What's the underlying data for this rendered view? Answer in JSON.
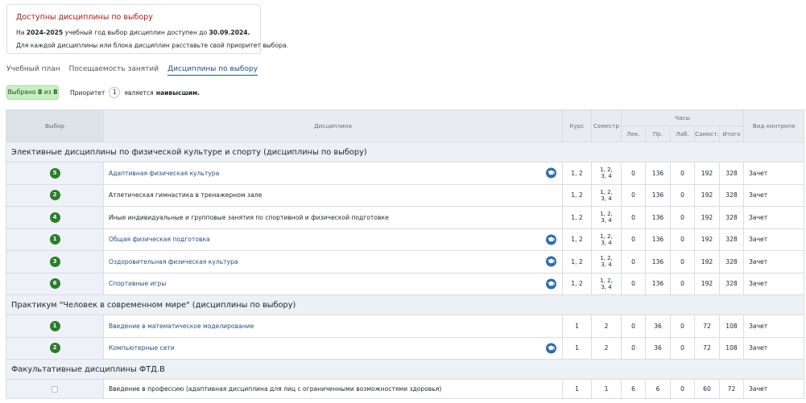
{
  "notice": {
    "title": "Доступны дисциплины по выбору",
    "line1_pre": "На ",
    "line1_year": "2024-2025",
    "line1_mid": " учебный год выбор дисциплин доступен до ",
    "line1_date": "30.09.2024.",
    "line2": "Для каждой дисциплины или блока дисциплин расставьте свой приоритет выбора."
  },
  "tabs": [
    {
      "label": "Учебный план",
      "active": false
    },
    {
      "label": "Посещаемость занятий",
      "active": false
    },
    {
      "label": "Дисциплины по выбору",
      "active": true
    }
  ],
  "selection": {
    "pre": "Выбрано ",
    "selected": "8",
    "mid": " из ",
    "total": "8"
  },
  "priority_note": {
    "pre": "Приоритет",
    "value": "1",
    "mid": "является",
    "bold": "наивысшим."
  },
  "table": {
    "headers": {
      "select": "Выбор",
      "discipline": "Дисциплина",
      "course": "Курс",
      "semester": "Семестр",
      "hours": "Часы",
      "lec": "Лек.",
      "pr": "Пр.",
      "lab": "Лаб.",
      "self": "Самост.",
      "total": "Итого",
      "control": "Вид контроля"
    },
    "sections": [
      {
        "title": "Элективные дисциплины по физической культуре и спорту (дисциплины по выбору)",
        "rows": [
          {
            "priority": "5",
            "name": "Адаптивная физическая культура",
            "link": true,
            "cap_icon": true,
            "course": "1, 2",
            "sem1": "1, 2,",
            "sem2": "3, 4",
            "lec": "0",
            "pr": "136",
            "lab": "0",
            "self": "192",
            "total": "328",
            "control": "Зачет"
          },
          {
            "priority": "2",
            "name": "Атлетическая гимнастика в тренажерном зале",
            "link": false,
            "cap_icon": false,
            "course": "1, 2",
            "sem1": "1, 2,",
            "sem2": "3, 4",
            "lec": "0",
            "pr": "136",
            "lab": "0",
            "self": "192",
            "total": "328",
            "control": "Зачет"
          },
          {
            "priority": "4",
            "name": "Иные индивидуальные и групповые занятия по спортивной и физической подготовке",
            "link": false,
            "cap_icon": false,
            "course": "1, 2",
            "sem1": "1, 2,",
            "sem2": "3, 4",
            "lec": "0",
            "pr": "136",
            "lab": "0",
            "self": "192",
            "total": "328",
            "control": "Зачет"
          },
          {
            "priority": "1",
            "name": "Общая физическая подготовка",
            "link": true,
            "cap_icon": true,
            "course": "1, 2",
            "sem1": "1, 2,",
            "sem2": "3, 4",
            "lec": "0",
            "pr": "136",
            "lab": "0",
            "self": "192",
            "total": "328",
            "control": "Зачет"
          },
          {
            "priority": "3",
            "name": "Оздоровительная физическая культура",
            "link": true,
            "cap_icon": true,
            "course": "1, 2",
            "sem1": "1, 2,",
            "sem2": "3, 4",
            "lec": "0",
            "pr": "136",
            "lab": "0",
            "self": "192",
            "total": "328",
            "control": "Зачет"
          },
          {
            "priority": "6",
            "name": "Спортивные игры",
            "link": true,
            "cap_icon": true,
            "course": "1, 2",
            "sem1": "1, 2,",
            "sem2": "3, 4",
            "lec": "0",
            "pr": "136",
            "lab": "0",
            "self": "192",
            "total": "328",
            "control": "Зачет"
          }
        ]
      },
      {
        "title": "Практикум \"Человек в современном мире\" (дисциплины по выбору)",
        "rows": [
          {
            "priority": "1",
            "name": "Введение в математическое моделирование",
            "link": true,
            "cap_icon": false,
            "course": "1",
            "sem1": "2",
            "sem2": "",
            "lec": "0",
            "pr": "36",
            "lab": "0",
            "self": "72",
            "total": "108",
            "control": "Зачет"
          },
          {
            "priority": "2",
            "name": "Компьютерные сети",
            "link": true,
            "cap_icon": true,
            "course": "1",
            "sem1": "2",
            "sem2": "",
            "lec": "0",
            "pr": "36",
            "lab": "0",
            "self": "72",
            "total": "108",
            "control": "Зачет"
          }
        ]
      },
      {
        "title": "Факультативные дисциплины ФТД.В",
        "rows": [
          {
            "priority": "",
            "checkbox": true,
            "name": "Введение в профессию (адаптивная дисциплина для лиц с ограниченными возможностями здоровья)",
            "link": false,
            "cap_icon": false,
            "course": "1",
            "sem1": "1",
            "sem2": "",
            "lec": "6",
            "pr": "6",
            "lab": "0",
            "self": "60",
            "total": "72",
            "control": "Зачет"
          }
        ]
      }
    ]
  },
  "colors": {
    "badge_green": "#2b7d2b",
    "link_blue": "#244f83",
    "notice_title_red": "#a52019",
    "pill_green": "#c7efc2",
    "cap_icon_blue": "#2e6ea8"
  }
}
